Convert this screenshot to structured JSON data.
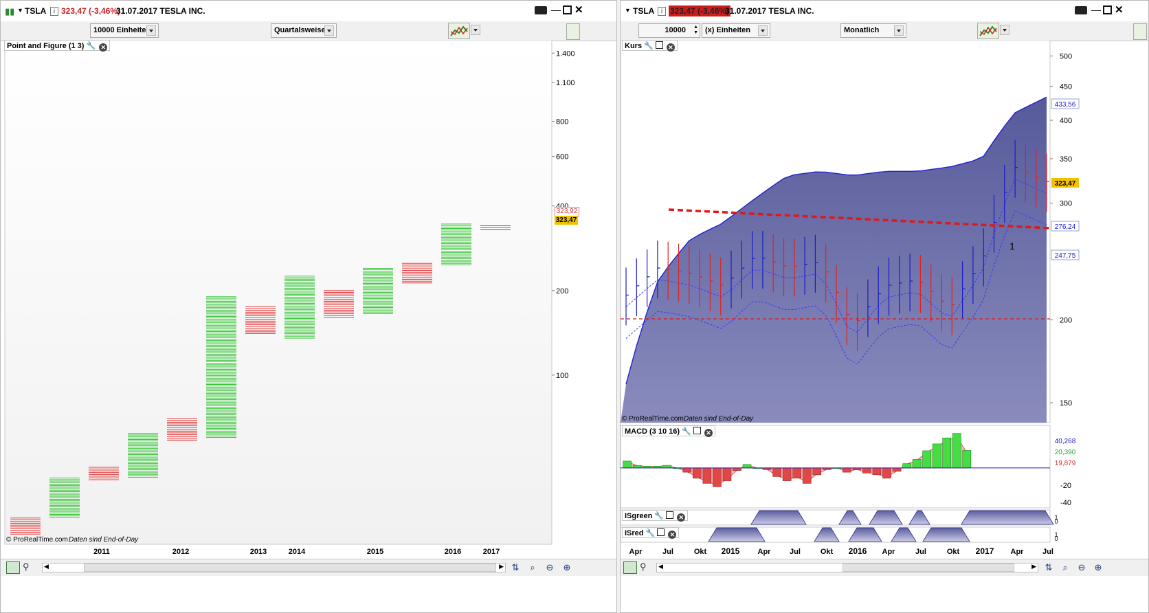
{
  "left": {
    "symbol": "TSLA",
    "price_change": "323,47 (-3,46%)",
    "date_name": "31.07.2017 TESLA INC.",
    "units_dropdown": "10000 Einheiten",
    "period_dropdown": "Quartalsweise",
    "panel_label": "Point and Figure (1 3)",
    "y_labels": [
      "1.400",
      "1.100",
      "800",
      "600",
      "400",
      "200",
      "100"
    ],
    "price_tag_red": "323,92",
    "price_tag_yellow": "323,47",
    "x_labels": [
      "2011",
      "2012",
      "2013",
      "2014",
      "2015",
      "2016",
      "2017"
    ],
    "watermark": "© ProRealTime.com",
    "watermark_note": "Daten sind End-of-Day"
  },
  "right": {
    "symbol": "TSLA",
    "price_change": "323,47 (-3,46%)",
    "date_name": "31.07.2017 TESLA INC.",
    "units_value": "10000",
    "units_dropdown": "(x) Einheiten",
    "period_dropdown": "Monatlich",
    "price_label": "Kurs",
    "macd_label": "MACD (3 10 16)",
    "isgreen_label": "ISgreen",
    "isred_label": "ISred",
    "price_y_labels": [
      "500",
      "450",
      "400",
      "350",
      "300",
      "200",
      "150"
    ],
    "tag_upper": "433,56",
    "tag_close": "323,47",
    "tag_mid": "276,24",
    "tag_lower": "247,75",
    "annotation": "1",
    "macd_y_labels": [
      "-20",
      "-40"
    ],
    "macd_tags": [
      "40,268",
      "20,390",
      "19,879"
    ],
    "indicator_y": [
      "1",
      "0"
    ],
    "x_labels": [
      "Apr",
      "Jul",
      "Okt",
      "2015",
      "Apr",
      "Jul",
      "Okt",
      "2016",
      "Apr",
      "Jul",
      "Okt",
      "2017",
      "Apr",
      "Jul"
    ],
    "watermark": "© ProRealTime.com",
    "watermark_note": "Daten sind End-of-Day"
  },
  "colors": {
    "up": "#21c221",
    "down": "#e02222",
    "band": "#5d5f9e",
    "accent_blue": "#1a1acc"
  },
  "chart_data": [
    {
      "type": "bar",
      "title": "Point and Figure (1 3)",
      "categories": [
        "2011",
        "",
        "",
        "",
        "2012",
        "",
        "2013",
        "2014",
        "",
        "2015",
        "",
        "2016",
        "2017"
      ],
      "series": [
        {
          "name": "O",
          "values": [
            [
              27,
              31
            ],
            null,
            [
              42,
              47
            ],
            null,
            [
              58,
              70
            ],
            null,
            [
              140,
              175
            ],
            null,
            [
              160,
              200
            ],
            null,
            [
              210,
              250
            ],
            null,
            [
              330,
              340
            ]
          ]
        },
        {
          "name": "X",
          "values": [
            null,
            [
              31,
              43
            ],
            null,
            [
              43,
              62
            ],
            null,
            [
              60,
              190
            ],
            null,
            [
              135,
              225
            ],
            null,
            [
              165,
              240
            ],
            null,
            [
              245,
              345
            ],
            null
          ]
        }
      ],
      "ylim": [
        25,
        1500
      ]
    },
    {
      "type": "line",
      "title": "Kurs",
      "x": [
        "Apr",
        "Jul",
        "Okt",
        "2015",
        "Apr",
        "Jul",
        "Okt",
        "2016",
        "Apr",
        "Jul",
        "Okt",
        "2017",
        "Apr",
        "Jul"
      ],
      "series": [
        {
          "name": "upper band",
          "values": [
            160,
            230,
            265,
            280,
            305,
            330,
            335,
            330,
            335,
            335,
            340,
            350,
            410,
            433.56
          ]
        },
        {
          "name": "close",
          "values": [
            218,
            240,
            235,
            225,
            250,
            240,
            245,
            195,
            225,
            230,
            208,
            245,
            340,
            323.47
          ]
        }
      ],
      "ylim": [
        140,
        520
      ]
    },
    {
      "type": "bar",
      "title": "MACD (3 10 16)",
      "values": [
        8,
        3,
        2,
        2,
        3,
        0,
        -5,
        -12,
        -18,
        -22,
        -15,
        -3,
        4,
        0,
        -2,
        -10,
        -15,
        -12,
        -18,
        -8,
        -2,
        0,
        -5,
        -2,
        -6,
        -8,
        -12,
        -4,
        5,
        10,
        20,
        28,
        35,
        40.268,
        20.39
      ],
      "ylim": [
        -45,
        48
      ]
    }
  ]
}
